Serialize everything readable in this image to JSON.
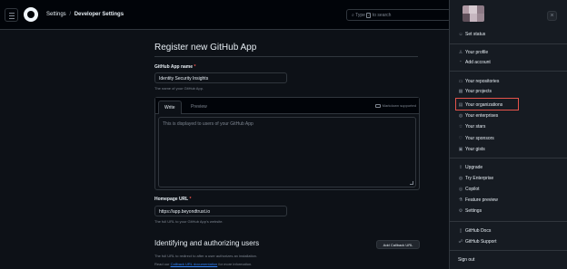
{
  "header": {
    "breadcrumb_root": "Settings",
    "breadcrumb_sep": "/",
    "breadcrumb_current": "Developer Settings",
    "search_prefix": "Type",
    "search_key": "/",
    "search_suffix": "to search"
  },
  "form": {
    "title": "Register new GitHub App",
    "name_label": "GitHub App name",
    "required_mark": "*",
    "name_value": "Identity Security Insights",
    "name_hint": "The name of your GitHub App.",
    "tab_write": "Write",
    "tab_preview": "Preview",
    "markdown_note": "Markdown supported",
    "description_placeholder": "This is displayed to users of your GitHub App",
    "homepage_label": "Homepage URL",
    "homepage_value": "https://app.beyondtrust.io",
    "homepage_hint": "The full URL to your GitHub App's website.",
    "section_title": "Identifying and authorizing users",
    "section_hint": "The full URL to redirect to after a user authorizes an installation.",
    "section_hint2_prefix": "Read our",
    "section_hint2_link": "Callback URL documentation",
    "section_hint2_suffix": "for more information.",
    "add_callback_label": "Add Callback URL"
  },
  "menu": {
    "close_glyph": "×",
    "highlighted_item": "Your organizations",
    "items": [
      {
        "label": "Set status",
        "icon": "smiley-icon",
        "glyph": "☺"
      },
      {
        "label": "Your profile",
        "icon": "person-icon",
        "glyph": "♙"
      },
      {
        "label": "Add account",
        "icon": "person-add-icon",
        "glyph": "⁺"
      },
      {
        "label": "Your repositories",
        "icon": "repo-icon",
        "glyph": "▭"
      },
      {
        "label": "Your projects",
        "icon": "table-icon",
        "glyph": "▦"
      },
      {
        "label": "Your organizations",
        "icon": "organization-icon",
        "glyph": "▤"
      },
      {
        "label": "Your enterprises",
        "icon": "globe-icon",
        "glyph": "◍"
      },
      {
        "label": "Your stars",
        "icon": "star-icon",
        "glyph": "☆"
      },
      {
        "label": "Your sponsors",
        "icon": "heart-icon",
        "glyph": "♡"
      },
      {
        "label": "Your gists",
        "icon": "code-square-icon",
        "glyph": "▣"
      },
      {
        "label": "Upgrade",
        "icon": "upload-icon",
        "glyph": "⇪"
      },
      {
        "label": "Try Enterprise",
        "icon": "globe-icon",
        "glyph": "◍"
      },
      {
        "label": "Copilot",
        "icon": "copilot-icon",
        "glyph": "◎"
      },
      {
        "label": "Feature preview",
        "icon": "beaker-icon",
        "glyph": "⚗"
      },
      {
        "label": "Settings",
        "icon": "gear-icon",
        "glyph": "⚙"
      },
      {
        "label": "GitHub Docs",
        "icon": "book-icon",
        "glyph": "▯"
      },
      {
        "label": "GitHub Support",
        "icon": "people-icon",
        "glyph": "☍"
      },
      {
        "label": "Sign out",
        "icon": "",
        "glyph": ""
      }
    ]
  },
  "colors": {
    "bg": "#0d1117",
    "header_bg": "#010409",
    "menu_bg": "#161b22",
    "border": "#30363d",
    "text": "#e6edf3",
    "muted": "#7d8590",
    "link": "#2f81f7",
    "highlight": "#e5534b"
  }
}
